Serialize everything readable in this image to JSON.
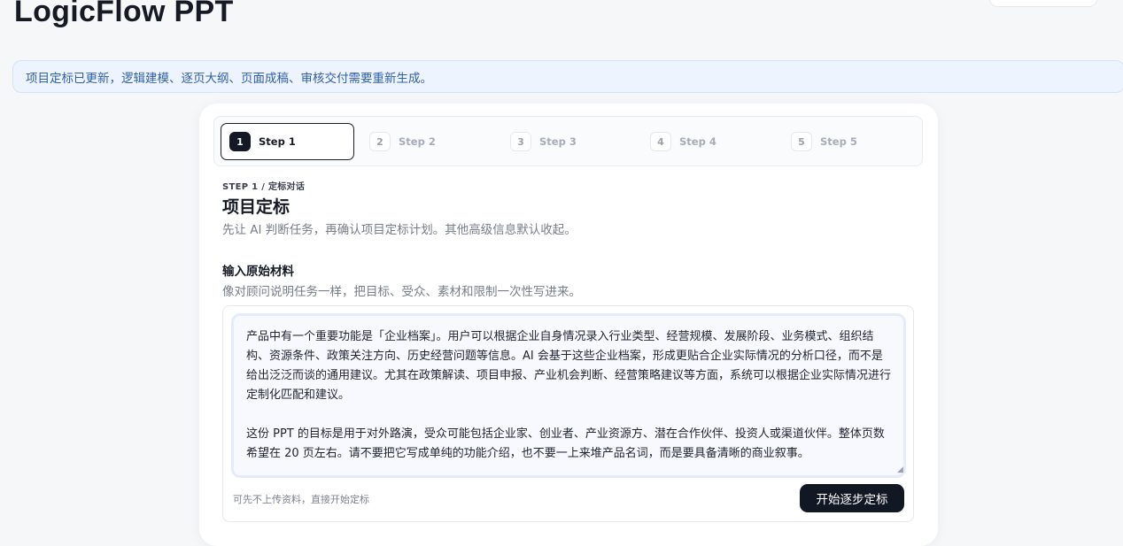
{
  "app": {
    "title": "LogicFlow PPT"
  },
  "notice": {
    "text": "项目定标已更新，逻辑建模、逐页大纲、页面成稿、审核交付需要重新生成。"
  },
  "stepper": {
    "steps": [
      {
        "num": "1",
        "label": "Step 1",
        "active": true
      },
      {
        "num": "2",
        "label": "Step 2",
        "active": false
      },
      {
        "num": "3",
        "label": "Step 3",
        "active": false
      },
      {
        "num": "4",
        "label": "Step 4",
        "active": false
      },
      {
        "num": "5",
        "label": "Step 5",
        "active": false
      }
    ]
  },
  "section": {
    "eyebrow": "STEP 1 / 定标对话",
    "title": "项目定标",
    "description": "先让 AI 判断任务，再确认项目定标计划。其他高级信息默认收起。"
  },
  "input": {
    "label": "输入原始材料",
    "description": "像对顾问说明任务一样，把目标、受众、素材和限制一次性写进来。",
    "value": "产品中有一个重要功能是「企业档案」。用户可以根据企业自身情况录入行业类型、经营规模、发展阶段、业务模式、组织结构、资源条件、政策关注方向、历史经营问题等信息。AI 会基于这些企业档案，形成更贴合企业实际情况的分析口径，而不是给出泛泛而谈的通用建议。尤其在政策解读、项目申报、产业机会判断、经营策略建议等方面，系统可以根据企业实际情况进行定制化匹配和建议。\n\n这份 PPT 的目标是用于对外路演，受众可能包括企业家、创业者、产业资源方、潜在合作伙伴、投资人或渠道伙伴。整体页数希望在 20 页左右。请不要把它写成单纯的功能介绍，也不要一上来堆产品名词，而是要具备清晰的商业叙事。",
    "hint": "可先不上传资料，直接开始定标",
    "submit_label": "开始逐步定标"
  },
  "colors": {
    "primary": "#121724",
    "notice_bg": "#eef4fd",
    "notice_text": "#2f5fa8"
  }
}
